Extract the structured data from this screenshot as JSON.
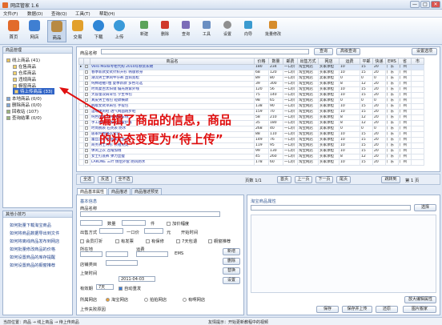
{
  "window": {
    "title": "网店管家 1.6",
    "controls": [
      "—",
      "□",
      "✕"
    ]
  },
  "menu": [
    "文件(F)",
    "数据(D)",
    "查询(Q)",
    "工具(T)",
    "帮助(H)"
  ],
  "toolbar": [
    {
      "label": "首页",
      "color": "#e26b2c"
    },
    {
      "label": "网店",
      "color": "#3f7fd2"
    },
    {
      "label": "商品",
      "color": "#b88a43"
    },
    {
      "label": "交易",
      "color": "#e2a02c"
    },
    {
      "label": "下载",
      "color": "#2f86d6"
    },
    {
      "label": "上传",
      "color": "#3a9ad9"
    }
  ],
  "toolbar_small": [
    {
      "label": "新建",
      "color": "#5ba35b"
    },
    {
      "label": "删除",
      "color": "#d0392c"
    },
    {
      "label": "查询",
      "color": "#7b6cb8"
    },
    {
      "label": "工具",
      "color": "#6b8fc2"
    },
    {
      "label": "设置",
      "color": "#8f8f8f"
    },
    {
      "label": "向导",
      "color": "#3b9bd0"
    },
    {
      "label": "批量修改",
      "color": "#d68c2c"
    }
  ],
  "tree": {
    "title": "商品管理",
    "items": [
      "线上商品 (41)",
      "在售商品",
      "仓库商品",
      "违规商品",
      "橱窗商品",
      "待上传商品 (33)",
      "本地商品 (0/0)",
      "删除商品 (0/0)",
      "回收站 (107)",
      "查询结果 (0/0)"
    ]
  },
  "help": {
    "title": "其他小技巧",
    "links": [
      "如何批量下载淘宝商品",
      "如何将商品数据导出到文件",
      "如何将离线商品发布到网店",
      "如何批量修改商品的价格",
      "如何设置商品的库存提醒",
      "如何设置商品的橱窗推荐"
    ]
  },
  "search": {
    "label": "商品名称",
    "button": "查询",
    "button2": "高级查询",
    "button3": "设置选项"
  },
  "grid": {
    "headers": [
      "",
      "",
      "商品名",
      "价格",
      "数量",
      "邮费",
      "出售方式",
      "网店",
      "运费",
      "平邮",
      "快递",
      "EMS",
      "省",
      "市"
    ],
    "rows": [
      [
        "Vero Moda专柜代购 2010年秋装长裙",
        "180",
        "234",
        "一口价",
        "淘宝网店",
        "买家承担",
        "10",
        "15",
        "20",
        "广东",
        "广州"
      ],
      [
        "春季新款女式针织开衫 韩版修身",
        "68",
        "120",
        "一口价",
        "淘宝网店",
        "买家承担",
        "10",
        "15",
        "20",
        "广东",
        "广州"
      ],
      [
        "潮流男士休闲牛仔裤 直筒宽松",
        "89",
        "80",
        "一口价",
        "淘宝网店",
        "卖家承担",
        "0",
        "0",
        "0",
        "广东",
        "广州"
      ],
      [
        "纯棉短袖T恤 夏季新款 多色可选",
        "39",
        "300",
        "一口价",
        "淘宝网店",
        "买家承担",
        "8",
        "12",
        "20",
        "广东",
        "广州"
      ],
      [
        "时尚复古太阳镜 偏光防紫外线",
        "120",
        "56",
        "一口价",
        "淘宝网店",
        "买家承担",
        "10",
        "15",
        "20",
        "广东",
        "广州"
      ],
      [
        "大容量双肩背包 学生书包",
        "75",
        "140",
        "一口价",
        "淘宝网店",
        "买家承担",
        "10",
        "15",
        "20",
        "广东",
        "广州"
      ],
      [
        "真皮男士钱包 短款横款",
        "98",
        "65",
        "一口价",
        "淘宝网店",
        "卖家承担",
        "0",
        "0",
        "0",
        "广东",
        "广州"
      ],
      [
        "韩版女式单肩包 手提包",
        "138",
        "90",
        "一口价",
        "淘宝网店",
        "买家承担",
        "10",
        "15",
        "20",
        "广东",
        "广州"
      ],
      [
        "运动休闲鞋 透气网面跑步鞋",
        "159",
        "70",
        "一口价",
        "淘宝网店",
        "买家承担",
        "10",
        "15",
        "20",
        "广东",
        "广州"
      ],
      [
        "纯色围巾 秋冬保暖羊绒",
        "58",
        "210",
        "一口价",
        "淘宝网店",
        "买家承担",
        "8",
        "12",
        "20",
        "广东",
        "广州"
      ],
      [
        "手工编织毛线帽 可爱护耳",
        "35",
        "180",
        "一口价",
        "淘宝网店",
        "买家承担",
        "8",
        "12",
        "20",
        "广东",
        "广州"
      ],
      [
        "时尚腕表 石英表 防水",
        "268",
        "40",
        "一口价",
        "淘宝网店",
        "卖家承担",
        "0",
        "0",
        "0",
        "广东",
        "广州"
      ],
      [
        "居家纯棉睡衣套装",
        "88",
        "110",
        "一口价",
        "淘宝网店",
        "买家承担",
        "10",
        "15",
        "20",
        "广东",
        "广州"
      ],
      [
        "蕾丝连衣裙 甜美公主风",
        "149",
        "76",
        "一口价",
        "淘宝网店",
        "买家承担",
        "10",
        "15",
        "20",
        "广东",
        "广州"
      ],
      [
        "商务男士衬衫 长袖免烫",
        "119",
        "95",
        "一口价",
        "淘宝网店",
        "买家承担",
        "10",
        "15",
        "20",
        "广东",
        "广州"
      ],
      [
        "休闲卫衣 连帽加绒",
        "99",
        "130",
        "一口价",
        "淘宝网店",
        "买家承担",
        "10",
        "15",
        "20",
        "广东",
        "广州"
      ],
      [
        "女士打底裤 弹力显瘦",
        "45",
        "260",
        "一口价",
        "淘宝网店",
        "买家承担",
        "8",
        "12",
        "20",
        "广东",
        "广州"
      ],
      [
        "LAKONE 三叶 情侣外套 防风防水",
        "178",
        "60",
        "一口价",
        "淘宝网店",
        "买家承担",
        "10",
        "15",
        "20",
        "广东",
        "广州"
      ]
    ]
  },
  "grid_toolbar": [
    "全选",
    "反选",
    "全不选"
  ],
  "pager": {
    "info": "页数 1/1",
    "buttons": [
      "首页",
      "上一页",
      "下一页",
      "尾页"
    ],
    "goto": "跳转到",
    "page": "第 1 页"
  },
  "tabs": [
    "商品基本属性",
    "商品描述",
    "商品描述预览"
  ],
  "form": {
    "section": "基本信息",
    "name": "商品名称",
    "count_label": "数量",
    "unit": "件",
    "sale": "出售方式",
    "price": "一口价",
    "yuan": "元",
    "shelf": "库存",
    "location": "所在地",
    "province": "广东",
    "city": "广州",
    "freight": "运费",
    "stuff": "卖家承担",
    "ems": "EMS",
    "cat": "商品类目",
    "cat2": "店铺类目",
    "list_time": "上架时间",
    "date": "2011-04-03",
    "days": "有效期",
    "days_val": "7天",
    "auto": "自动重发",
    "checks": [
      "加价幅度",
      "开始时间",
      "会员打折",
      "有发票",
      "有保修",
      "7天包退",
      "橱窗推荐"
    ],
    "side_btns": [
      "新增",
      "删除",
      "替换",
      "设置"
    ],
    "shop_label": "所属网店",
    "shops": [
      "淘宝网店",
      "拍拍网店",
      "有啊网店"
    ],
    "store_label": "上传失败原因",
    "btns": [
      "保存",
      "保存并上传",
      "还原",
      "图片搬家"
    ]
  },
  "props": {
    "title": "淘宝商品属性",
    "select": "选择",
    "btn": "放大编辑属性"
  },
  "annotation": {
    "line1": "编辑了商品的信息，商品",
    "line2": "的状态变更为“待上传”"
  },
  "status": {
    "left": "当前位置：商品 → 线上商品 → 待上传商品",
    "right": "友情提示：开始更新教程中的视频"
  }
}
